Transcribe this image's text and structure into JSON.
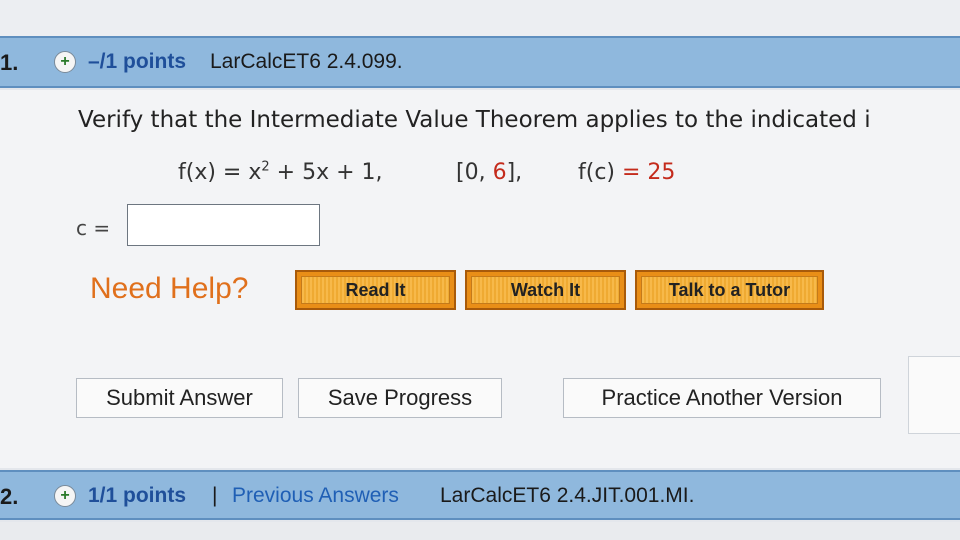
{
  "q1": {
    "number": "1.",
    "expand": "+",
    "points": "–/1 points",
    "code": "LarCalcET6 2.4.099."
  },
  "prompt": "Verify that the Intermediate Value Theorem applies to the indicated i",
  "equation": {
    "fx": "f(x) = x",
    "exp": "2",
    "rest": " + 5x + 1,",
    "interval_open": "[0,",
    "interval_val": "6",
    "interval_close": "],",
    "fc": "f(c)",
    "fc_eq": " = 25"
  },
  "answer": {
    "label": "c =",
    "value": ""
  },
  "help": {
    "label": "Need Help?",
    "read": "Read It",
    "watch": "Watch It",
    "tutor": "Talk to a Tutor"
  },
  "actions": {
    "submit": "Submit Answer",
    "save": "Save Progress",
    "practice": "Practice Another Version"
  },
  "q2": {
    "number": "2.",
    "expand": "+",
    "points": "1/1 points",
    "separator": "|",
    "previous": "Previous Answers",
    "code": "LarCalcET6 2.4.JIT.001.MI."
  },
  "colors": {
    "header_bg": "#8fb8dd",
    "need_help": "#e0701c",
    "help_button": "#e98e17",
    "points": "#1f4f9a"
  }
}
